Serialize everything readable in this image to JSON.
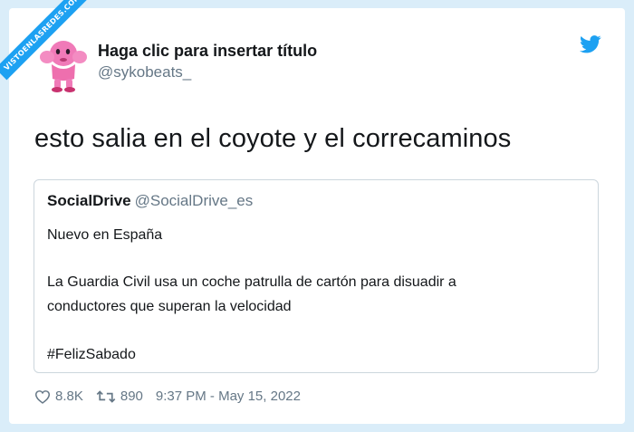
{
  "watermark": "VISTOENLASREDES.COM",
  "tweet": {
    "display_name": "Haga clic para insertar título",
    "handle": "@sykobeats_",
    "text": "esto salia en el coyote y el correcaminos"
  },
  "quoted": {
    "name": "SocialDrive",
    "handle": "@SocialDrive_es",
    "line1": "Nuevo en España",
    "line2": "La Guardia Civil usa un coche patrulla de cartón para disuadir a",
    "line3": "conductores que superan la velocidad",
    "line4": "#FelizSabado"
  },
  "footer": {
    "likes": "8.8K",
    "retweets": "890",
    "timestamp": "9:37 PM - May 15, 2022"
  },
  "icons": {
    "heart": "heart-icon",
    "retweet": "retweet-icon",
    "bird": "twitter-bird-icon"
  },
  "colors": {
    "twitter_blue": "#1da1f2",
    "avatar_pink": "#f07ab8",
    "text_secondary": "#657786"
  }
}
